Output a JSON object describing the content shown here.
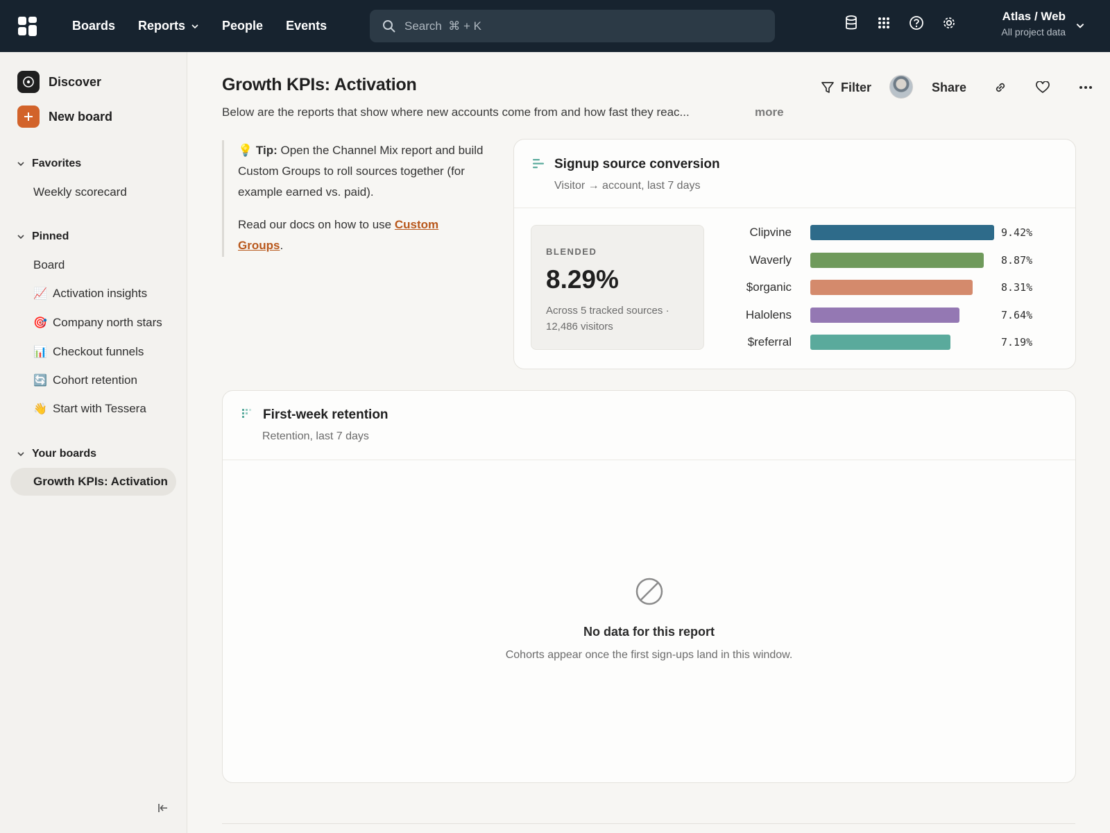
{
  "topbar": {
    "nav": [
      {
        "label": "Boards"
      },
      {
        "label": "Reports",
        "has_menu": true
      },
      {
        "label": "People"
      },
      {
        "label": "Events"
      }
    ],
    "search_placeholder": "Search  ⌘ + K",
    "icons": [
      "database-icon",
      "apps-grid-icon",
      "help-icon",
      "settings-icon"
    ],
    "project_name": "Atlas / Web",
    "project_scope": "All project data"
  },
  "sidebar": {
    "discover_label": "Discover",
    "new_board_label": "New board",
    "favorites": {
      "label": "Favorites",
      "items": [
        "Weekly scorecard"
      ]
    },
    "pinned": {
      "label": "Pinned",
      "items": [
        {
          "emoji": "",
          "label": "Board"
        },
        {
          "emoji": "📈",
          "label": "Activation insights"
        },
        {
          "emoji": "🎯",
          "label": "Company north stars"
        },
        {
          "emoji": "📊",
          "label": "Checkout funnels"
        },
        {
          "emoji": "🔄",
          "label": "Cohort retention"
        },
        {
          "emoji": "👋",
          "label": "Start with Tessera"
        }
      ]
    },
    "your_boards": {
      "label": "Your boards",
      "items": [
        "Growth KPIs: Activation"
      ]
    }
  },
  "board": {
    "title": "Growth KPIs: Activation",
    "description": "Below are the reports that show where new accounts come from and how fast they reac...",
    "more_label": "more",
    "filter_label": "Filter",
    "share_label": "Share"
  },
  "tip": {
    "emoji": "💡",
    "bold": "Tip:",
    "text": "Open the Channel Mix report and build Custom Groups to roll sources together (for example earned vs. paid).",
    "docs_prefix": "Read our docs on how to use",
    "docs_link": "Custom Groups",
    "docs_suffix": "."
  },
  "signup_card": {
    "title": "Signup source conversion",
    "subtitle": "Visitor → account, last 7 days",
    "blended_label": "BLENDED",
    "blended_value": "8.29%",
    "blended_note": "Across 5 tracked sources · 12,486 visitors"
  },
  "chart_data": {
    "type": "bar",
    "orientation": "horizontal",
    "categories": [
      "Clipvine",
      "Waverly",
      "$organic",
      "Halolens",
      "$referral"
    ],
    "values": [
      9.42,
      8.87,
      8.31,
      7.64,
      7.19
    ],
    "value_labels": [
      "9.42%",
      "8.87%",
      "8.31%",
      "7.64%",
      "7.19%"
    ],
    "colors": [
      "#2e6b8a",
      "#6f9a5b",
      "#d48a6c",
      "#9478b3",
      "#5aaa9c"
    ],
    "xlim": [
      0,
      9.42
    ]
  },
  "retention_card": {
    "title": "First-week retention",
    "subtitle": "Retention, last 7 days",
    "empty_title": "No data for this report",
    "empty_text": "Cohorts appear once the first sign-ups land in this window."
  }
}
